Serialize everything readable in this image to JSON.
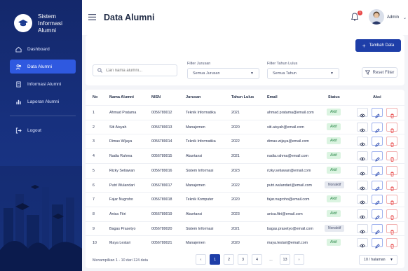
{
  "sidebar": {
    "brand": "Sistem Informasi Alumni",
    "items": [
      {
        "label": "Dashboard",
        "icon": "home-icon"
      },
      {
        "label": "Data Alumni",
        "icon": "users-icon"
      },
      {
        "label": "Informasi Alumni",
        "icon": "document-icon"
      },
      {
        "label": "Laporan Alumni",
        "icon": "bar-chart-icon"
      }
    ],
    "logout": "Logout"
  },
  "header": {
    "title": "Data Alumni",
    "notification_count": "1",
    "user_name": "Admin"
  },
  "toolbar": {
    "add_label": "Tambah Data",
    "search_placeholder": "Cari nama alumni...",
    "jurusan_label": "Filter Jurusan",
    "jurusan_value": "Semua Jurusan",
    "tahun_label": "Filter Tahun Lulus",
    "tahun_value": "Semua Tahun",
    "reset_label": "Reset Filter"
  },
  "table": {
    "columns": [
      "No",
      "Nama Alumni",
      "NISN",
      "Jurusan",
      "Tahun Lulus",
      "Email",
      "Status",
      "Aksi"
    ],
    "rows": [
      {
        "no": "1",
        "nama": "Ahmad Pratama",
        "nisn": "0056789012",
        "jurusan": "Teknik Informatika",
        "tahun": "2021",
        "email": "ahmad.pratama@email.com",
        "status": "Aktif"
      },
      {
        "no": "2",
        "nama": "Siti Aisyah",
        "nisn": "0056789013",
        "jurusan": "Manajemen",
        "tahun": "2020",
        "email": "siti.aisyah@email.com",
        "status": "Aktif"
      },
      {
        "no": "3",
        "nama": "Dimas Wijaya",
        "nisn": "0056789014",
        "jurusan": "Teknik Informatika",
        "tahun": "2022",
        "email": "dimas.wijaya@email.com",
        "status": "Aktif"
      },
      {
        "no": "4",
        "nama": "Nadia Rahma",
        "nisn": "0056789015",
        "jurusan": "Akuntansi",
        "tahun": "2021",
        "email": "nadia.rahma@email.com",
        "status": "Aktif"
      },
      {
        "no": "5",
        "nama": "Rizky Setiawan",
        "nisn": "0056789016",
        "jurusan": "Sistem Informasi",
        "tahun": "2023",
        "email": "rizky.setiawan@email.com",
        "status": "Aktif"
      },
      {
        "no": "6",
        "nama": "Putri Wulandari",
        "nisn": "0056789017",
        "jurusan": "Manajemen",
        "tahun": "2022",
        "email": "putri.wulandari@email.com",
        "status": "Nonaktif"
      },
      {
        "no": "7",
        "nama": "Fajar Nugroho",
        "nisn": "0056789018",
        "jurusan": "Teknik Komputer",
        "tahun": "2020",
        "email": "fajar.nugroho@email.com",
        "status": "Aktif"
      },
      {
        "no": "8",
        "nama": "Anisa Fitri",
        "nisn": "0056789019",
        "jurusan": "Akuntansi",
        "tahun": "2023",
        "email": "anisa.fitri@email.com",
        "status": "Aktif"
      },
      {
        "no": "9",
        "nama": "Bagas Prasetyo",
        "nisn": "0056789020",
        "jurusan": "Sistem Informasi",
        "tahun": "2021",
        "email": "bagas.prasetyo@email.com",
        "status": "Nonaktif"
      },
      {
        "no": "10",
        "nama": "Maya Lestari",
        "nisn": "0056789021",
        "jurusan": "Manajemen",
        "tahun": "2020",
        "email": "maya.lestari@email.com",
        "status": "Aktif"
      }
    ],
    "footer_text": "Menampilkan 1 - 10 dari 124 data"
  },
  "pagination": {
    "pages": [
      "1",
      "2",
      "3",
      "4",
      "...",
      "13"
    ],
    "current": "1",
    "per_page": "10 / halaman"
  },
  "colors": {
    "primary": "#1e3ea8",
    "sidebar": "#17307e",
    "active": "#2f59e0",
    "aktif": "#2e8a4c",
    "danger": "#e84545"
  }
}
